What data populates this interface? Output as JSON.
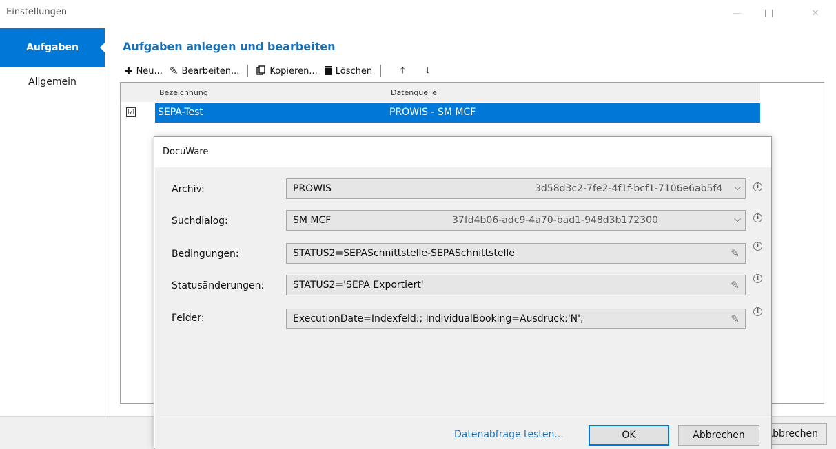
{
  "window": {
    "title": "Einstellungen",
    "minimize_icon": "minimize-icon",
    "maximize_icon": "maximize-icon",
    "close_label": "✕"
  },
  "sidebar": {
    "items": [
      {
        "label": "Aufgaben",
        "active": true
      },
      {
        "label": "Allgemein",
        "active": false
      }
    ]
  },
  "main": {
    "title": "Aufgaben anlegen und bearbeiten",
    "toolbar": {
      "new_label": "Neu...",
      "edit_label": "Bearbeiten...",
      "copy_label": "Kopieren...",
      "delete_label": "Löschen",
      "up_label": "🡑",
      "down_label": "🡓"
    },
    "grid": {
      "columns": [
        "Bezeichnung",
        "Datenquelle"
      ],
      "rows": [
        {
          "checked": true,
          "check_mark": "☑",
          "name": "SEPA-Test",
          "source": "PROWIS - SM MCF"
        }
      ]
    },
    "cancel_partial": "Abbrechen"
  },
  "dialog": {
    "title": "DocuWare",
    "fields": [
      {
        "label": "Archiv:",
        "value": "PROWIS",
        "guid": "3d58d3c2-7fe2-4f1f-bcf1-7106e6ab5f4",
        "kind": "select"
      },
      {
        "label": "Suchdialog:",
        "value": "SM MCF",
        "guid": "37fd4b06-adc9-4a70-bad1-948d3b172300",
        "kind": "select"
      },
      {
        "label": "Bedingungen:",
        "value": "STATUS2=SEPASchnittstelle-SEPASchnittstelle",
        "kind": "edit"
      },
      {
        "label": "Statusänderungen:",
        "value": "STATUS2='SEPA Exportiert'",
        "kind": "edit"
      },
      {
        "label": "Felder:",
        "value": "ExecutionDate=Indexfeld:; IndividualBooking=Ausdruck:'N';",
        "kind": "edit"
      }
    ],
    "info_glyph": "i",
    "footer": {
      "test_link": "Datenabfrage testen...",
      "ok_label": "OK",
      "cancel_label": "Abbrechen"
    }
  },
  "colors": {
    "accent": "#0078d7",
    "link": "#1a6fb5"
  }
}
